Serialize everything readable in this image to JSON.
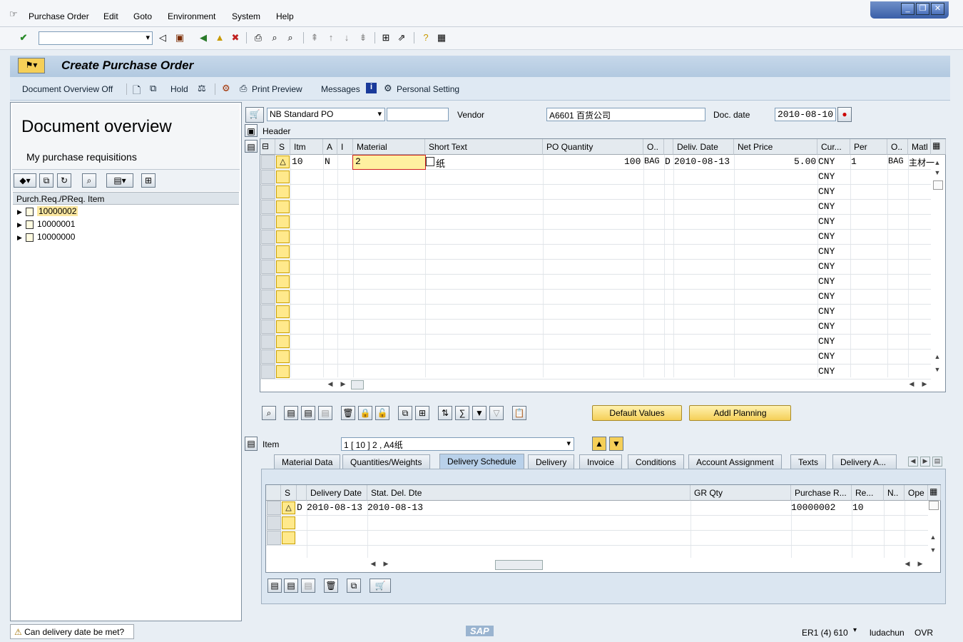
{
  "menu": {
    "items": [
      "Purchase Order",
      "Edit",
      "Goto",
      "Environment",
      "System",
      "Help"
    ]
  },
  "window_controls": {
    "minimize": "_",
    "restore": "❐",
    "close": "✕"
  },
  "title": "Create Purchase Order",
  "apptoolbar": {
    "doc_overview": "Document Overview Off",
    "hold": "Hold",
    "print_preview": "Print Preview",
    "messages": "Messages",
    "personal_setting": "Personal Setting"
  },
  "left": {
    "heading": "Document overview",
    "sub": "My purchase requisitions",
    "column": "Purch.Req./PReq. Item",
    "items": [
      "10000002",
      "10000001",
      "10000000"
    ]
  },
  "header": {
    "doc_type": "NB Standard PO",
    "vendor_label": "Vendor",
    "vendor": "A6601 百货公司",
    "docdate_label": "Doc. date",
    "docdate": "2010-08-10",
    "header_label": "Header"
  },
  "items_table": {
    "columns": [
      "S",
      "Itm",
      "A",
      "I",
      "Material",
      "Short Text",
      "PO Quantity",
      "O..",
      "Deliv. Date",
      "Net Price",
      "Cur...",
      "Per",
      "O..",
      "Matl"
    ],
    "row1": {
      "itm": "10",
      "a": "N",
      "material": "2",
      "short_text": "纸",
      "qty": "100",
      "unit": "BAG",
      "d": "D",
      "deliv": "2010-08-13",
      "price": "5.00",
      "cur": "CNY",
      "per": "1",
      "ou": "BAG",
      "matl": "主材一"
    },
    "empty_cur": "CNY"
  },
  "buttons": {
    "default_values": "Default Values",
    "addl_planning": "Addl Planning"
  },
  "item": {
    "label": "Item",
    "value": "1 [ 10 ] 2 , A4纸"
  },
  "tabs": [
    "Material Data",
    "Quantities/Weights",
    "Delivery Schedule",
    "Delivery",
    "Invoice",
    "Conditions",
    "Account Assignment",
    "Texts",
    "Delivery A..."
  ],
  "schedule": {
    "columns": [
      "S",
      "Delivery Date",
      "Stat. Del. Dte",
      "GR Qty",
      "Purchase R...",
      "Re...",
      "N..",
      "Ope"
    ],
    "row1": {
      "d": "D",
      "deliv": "2010-08-13",
      "stat": "2010-08-13",
      "preq": "10000002",
      "re": "10"
    }
  },
  "status": {
    "message": "Can delivery date be met?",
    "system": "ER1 (4) 610",
    "user": "ludachun",
    "mode": "OVR",
    "logo": "SAP"
  }
}
